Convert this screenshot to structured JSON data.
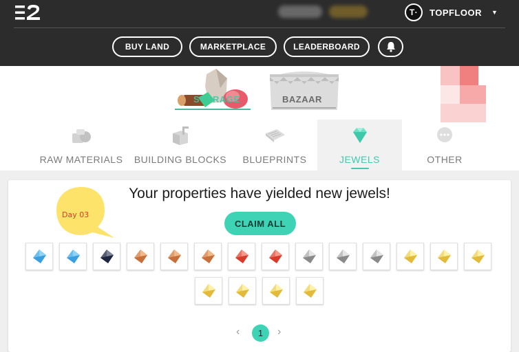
{
  "header": {
    "user_initial": "T·",
    "user_name": "TOPFLOOR",
    "nav": [
      "BUY LAND",
      "MARKETPLACE",
      "LEADERBOARD"
    ]
  },
  "shops": {
    "storage_label": "STORAGE",
    "bazaar_label": "BAZAAR"
  },
  "tabs": [
    {
      "label": "RAW MATERIALS",
      "icon": "raw-materials-icon",
      "active": false
    },
    {
      "label": "BUILDING BLOCKS",
      "icon": "building-blocks-icon",
      "active": false
    },
    {
      "label": "BLUEPRINTS",
      "icon": "blueprints-icon",
      "active": false
    },
    {
      "label": "JEWELS",
      "icon": "jewels-icon",
      "active": true
    },
    {
      "label": "OTHER",
      "icon": "other-icon",
      "active": false
    }
  ],
  "card": {
    "badge": "Day 03",
    "headline": "Your properties have yielded new jewels!",
    "claim_label": "CLAIM ALL"
  },
  "jewels_row1": [
    "blue",
    "blue",
    "navy",
    "bronze",
    "bronze",
    "bronze",
    "red",
    "red",
    "silver",
    "silver",
    "silver",
    "gold",
    "gold",
    "gold"
  ],
  "jewels_row2": [
    "gold",
    "gold",
    "gold",
    "gold"
  ],
  "jewel_colors": {
    "blue": [
      "#8fd3f5",
      "#3a9fe0"
    ],
    "navy": [
      "#7d8597",
      "#1e2540"
    ],
    "bronze": [
      "#f0b98a",
      "#c8703c"
    ],
    "red": [
      "#f59a8a",
      "#d93a2a"
    ],
    "silver": [
      "#e6e6e6",
      "#8a8a8a"
    ],
    "gold": [
      "#fff1a8",
      "#e2bb3a"
    ]
  },
  "pagination": {
    "prev": "‹",
    "current": "1",
    "next": "›"
  },
  "colors": {
    "accent": "#3ed3b4",
    "header_bg": "#2c2c2c"
  }
}
